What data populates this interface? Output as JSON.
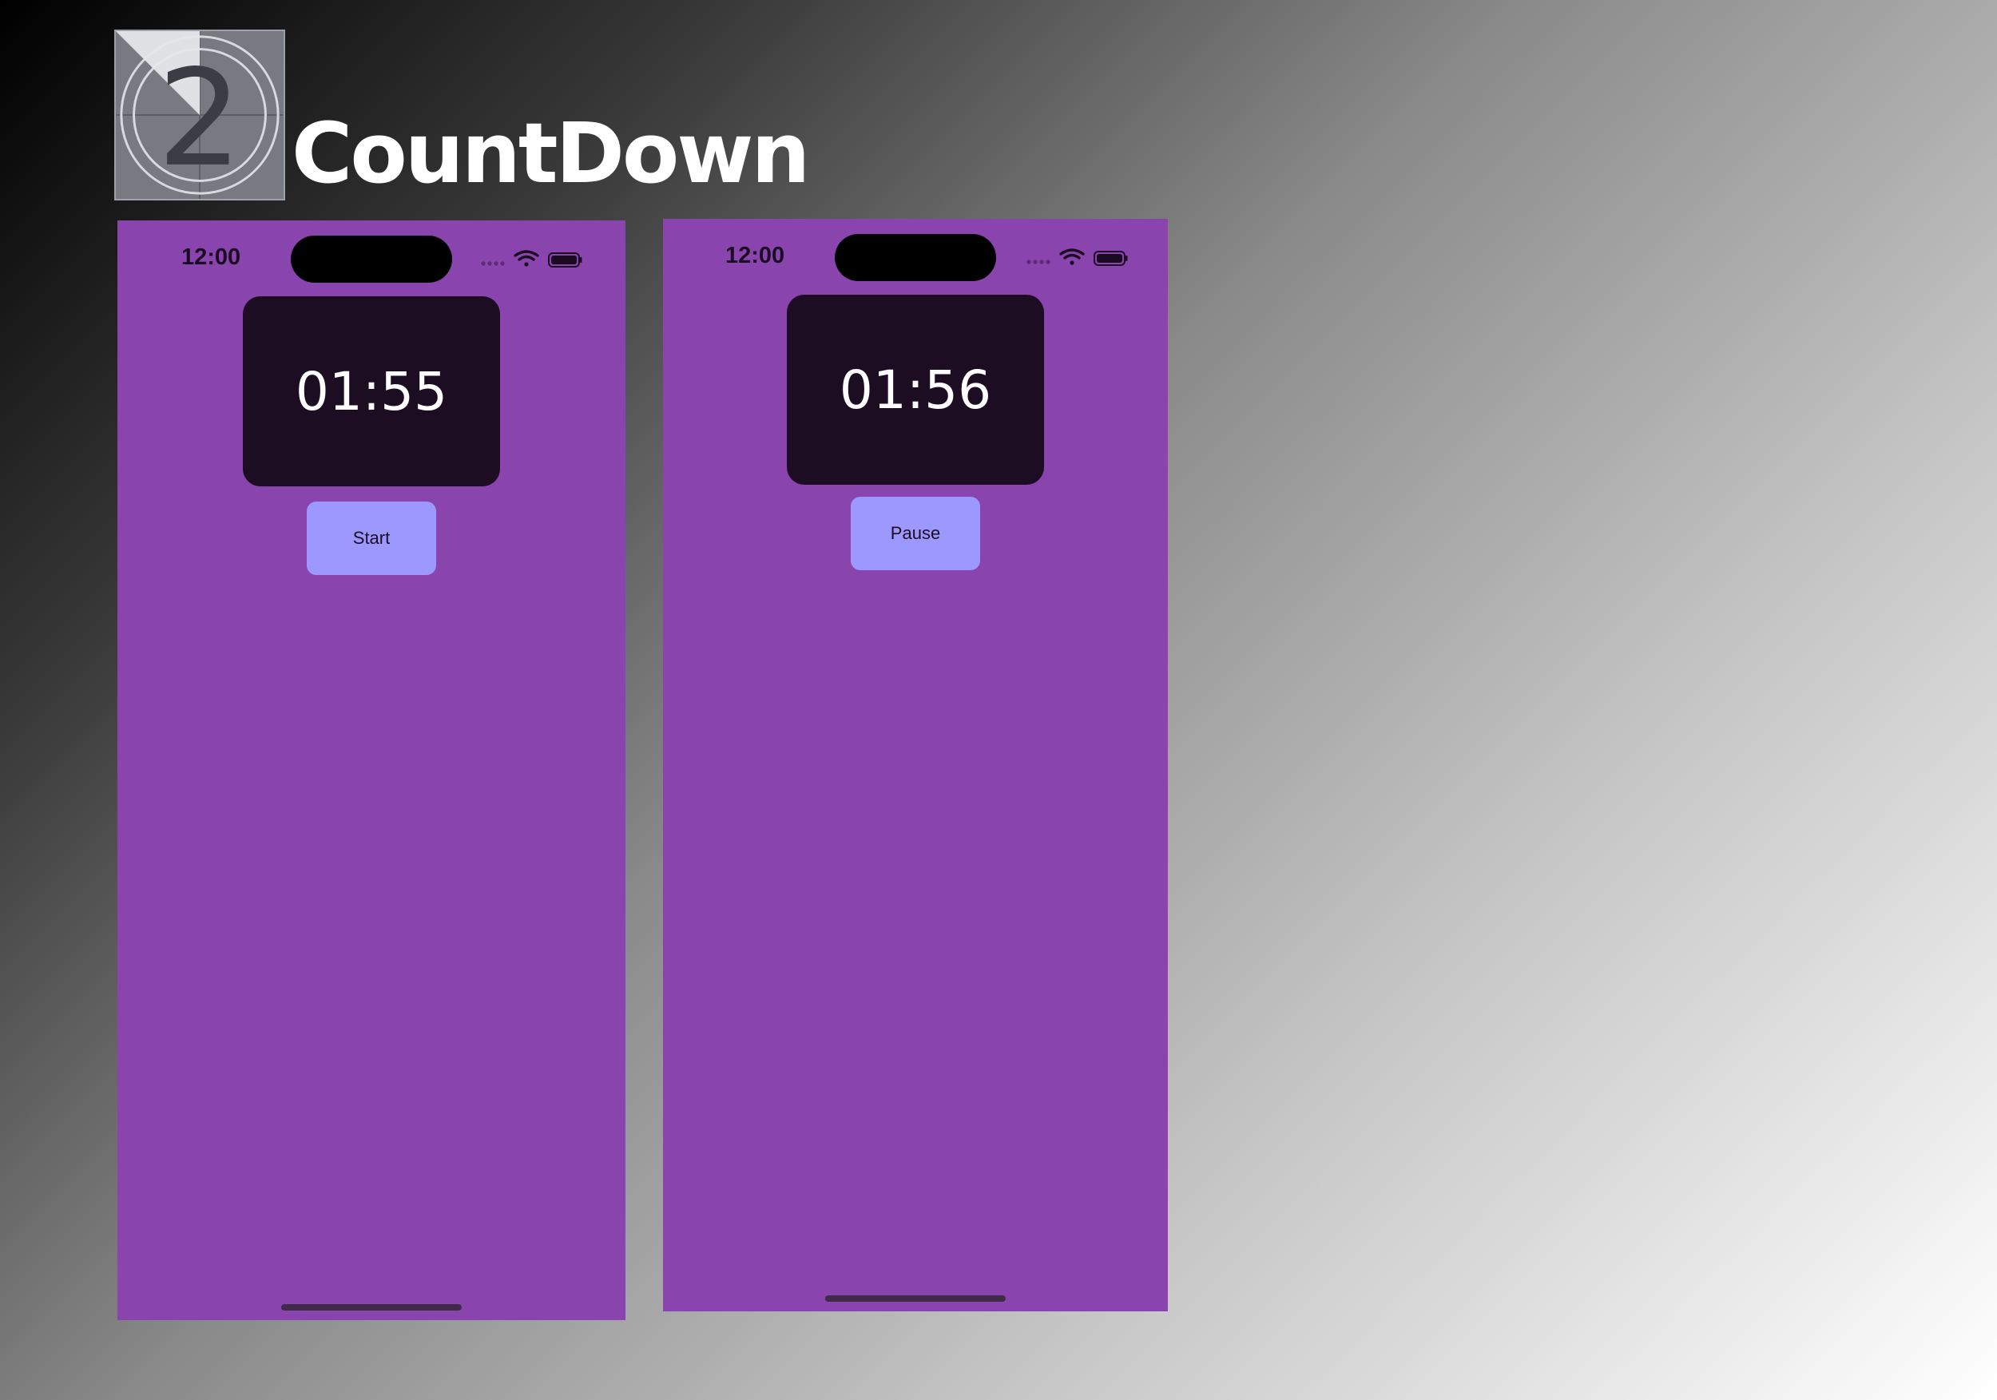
{
  "header": {
    "logo_icon": "countdown-leader-icon",
    "logo_digit": "2",
    "title": "CountDown"
  },
  "colors": {
    "phone_background": "#8a44ae",
    "timer_background": "#1d0d22",
    "button_background": "#9c98fe",
    "timer_text": "#ffffff"
  },
  "screens": [
    {
      "status_time": "12:00",
      "icons": [
        "signal-dots-icon",
        "wifi-icon",
        "battery-icon"
      ],
      "timer": "01:55",
      "button_label": "Start"
    },
    {
      "status_time": "12:00",
      "icons": [
        "signal-dots-icon",
        "wifi-icon",
        "battery-icon"
      ],
      "timer": "01:56",
      "button_label": "Pause"
    }
  ]
}
